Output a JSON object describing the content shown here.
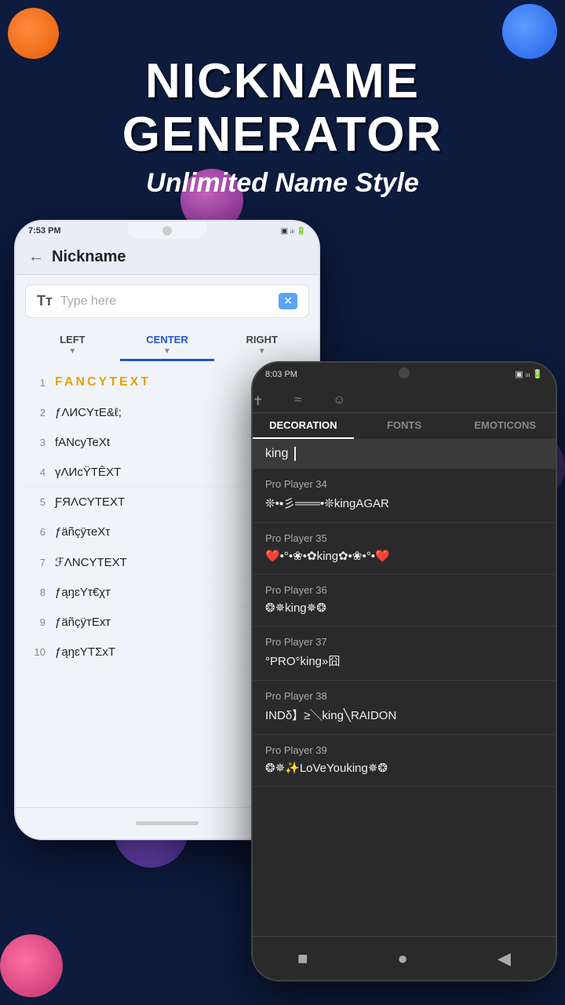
{
  "background": {
    "color": "#0d1b3e"
  },
  "header": {
    "main_title": "NICKNAME GENERATOR",
    "sub_title": "Unlimited Name Style"
  },
  "left_phone": {
    "status_time": "7:53 PM",
    "status_icons": "📶 🔋57",
    "app_title": "Nickname",
    "input_placeholder": "Type here",
    "alignment_options": [
      "LEFT",
      "CENTER",
      "RIGHT"
    ],
    "active_alignment": "CENTER",
    "fancy_items": [
      {
        "num": "1",
        "text": "FANCYTEXT",
        "highlight": true
      },
      {
        "num": "2",
        "text": "ƒΛИCΥτE&ℓ;"
      },
      {
        "num": "3",
        "text": "fΑNcyTeXt"
      },
      {
        "num": "4",
        "text": "γΛИcΫTÊXT"
      },
      {
        "num": "5",
        "text": "ƑЯΛCΥΤΕΧΤ"
      },
      {
        "num": "6",
        "text": "ƒäñçÿτeXτ"
      },
      {
        "num": "7",
        "text": "ℱΛNСΥТΕΧΤ"
      },
      {
        "num": "8",
        "text": "ƒąŋɛΥτ€χт"
      },
      {
        "num": "9",
        "text": "ƒäñçÿтEхт"
      },
      {
        "num": "10",
        "text": "ƒąŋɛΥТΣхТ"
      }
    ]
  },
  "right_phone": {
    "status_time": "8:03 PM",
    "status_icons": "📶 🔋55",
    "tab_icons": [
      "✝",
      "≈",
      "☺"
    ],
    "tabs": [
      "DECORATION",
      "FONTS",
      "EMOTICONS"
    ],
    "active_tab": "DECORATION",
    "search_text": "king",
    "results": [
      {
        "player_name": "Pro Player 34",
        "styled_text": "❊•▪︎彡═══•❊kingAGAR"
      },
      {
        "player_name": "Pro Player 35",
        "styled_text": "❤️•°•❀•✿king✿•❀•°•❤️"
      },
      {
        "player_name": "Pro Player 36",
        "styled_text": "❂✵king✵❂"
      },
      {
        "player_name": "Pro Player 37",
        "styled_text": "°PRO°king»囧"
      },
      {
        "player_name": "Pro Player 38",
        "styled_text": "INDδ】≥╲king╲RAIDON"
      },
      {
        "player_name": "Pro Player 39",
        "styled_text": "❂✵✨LoVeYouking✵❂"
      }
    ],
    "nav_btns": [
      "■",
      "●",
      "◀"
    ]
  }
}
